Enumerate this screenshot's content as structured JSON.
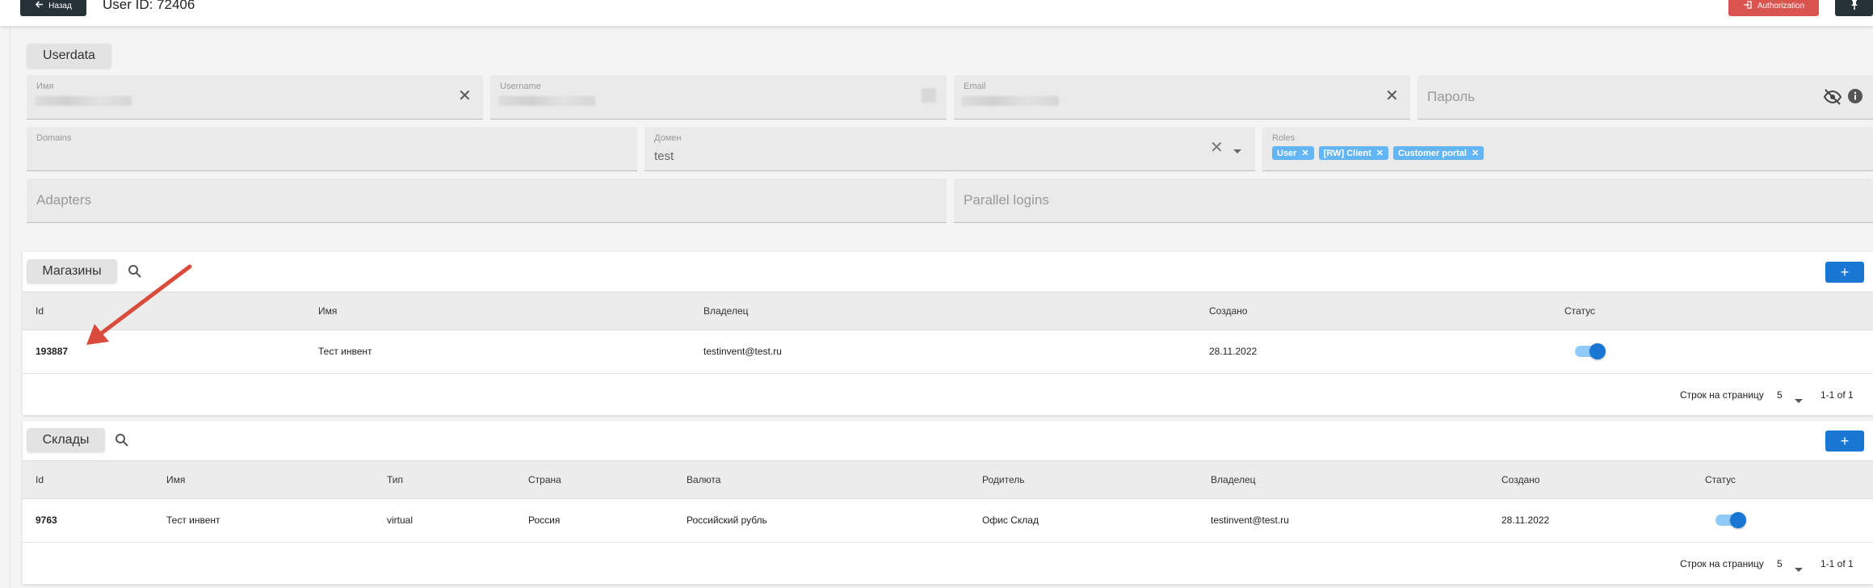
{
  "header": {
    "back_label": "Назад",
    "user_id": "User ID: 72406",
    "auth_label": "Authorization"
  },
  "userdata": {
    "section_label": "Userdata",
    "name_label": "Имя",
    "username_label": "Username",
    "email_label": "Email",
    "password_placeholder": "Пароль",
    "domains_label": "Domains",
    "domain_label": "Домен",
    "domain_value": "test",
    "roles_label": "Roles",
    "roles": [
      "User",
      "[RW] Client",
      "Customer portal"
    ],
    "adapters_placeholder": "Adapters",
    "parallel_logins_placeholder": "Parallel logins"
  },
  "shops": {
    "section_label": "Магазины",
    "columns": [
      "Id",
      "Имя",
      "Владелец",
      "Создано",
      "Статус"
    ],
    "rows": [
      {
        "id": "193887",
        "name": "Тест инвент",
        "owner": "testinvent@test.ru",
        "created": "28.11.2022",
        "status": true
      }
    ],
    "rows_per_page_label": "Строк на страницу",
    "rows_per_page": "5",
    "range": "1-1 of 1",
    "add_label": "+"
  },
  "warehouses": {
    "section_label": "Склады",
    "columns": [
      "Id",
      "Имя",
      "Тип",
      "Страна",
      "Валюта",
      "Родитель",
      "Владелец",
      "Создано",
      "Статус"
    ],
    "rows": [
      {
        "id": "9763",
        "name": "Тест инвент",
        "type": "virtual",
        "country": "Россия",
        "currency": "Российский рубль",
        "parent": "Офис Склад",
        "owner": "testinvent@test.ru",
        "created": "28.11.2022",
        "status": true
      }
    ],
    "rows_per_page_label": "Строк на страницу",
    "rows_per_page": "5",
    "range": "1-1 of 1",
    "add_label": "+"
  },
  "colors": {
    "accent": "#1976d2",
    "danger": "#d9534f",
    "dark": "#263238",
    "arrow": "#d94c3d"
  }
}
